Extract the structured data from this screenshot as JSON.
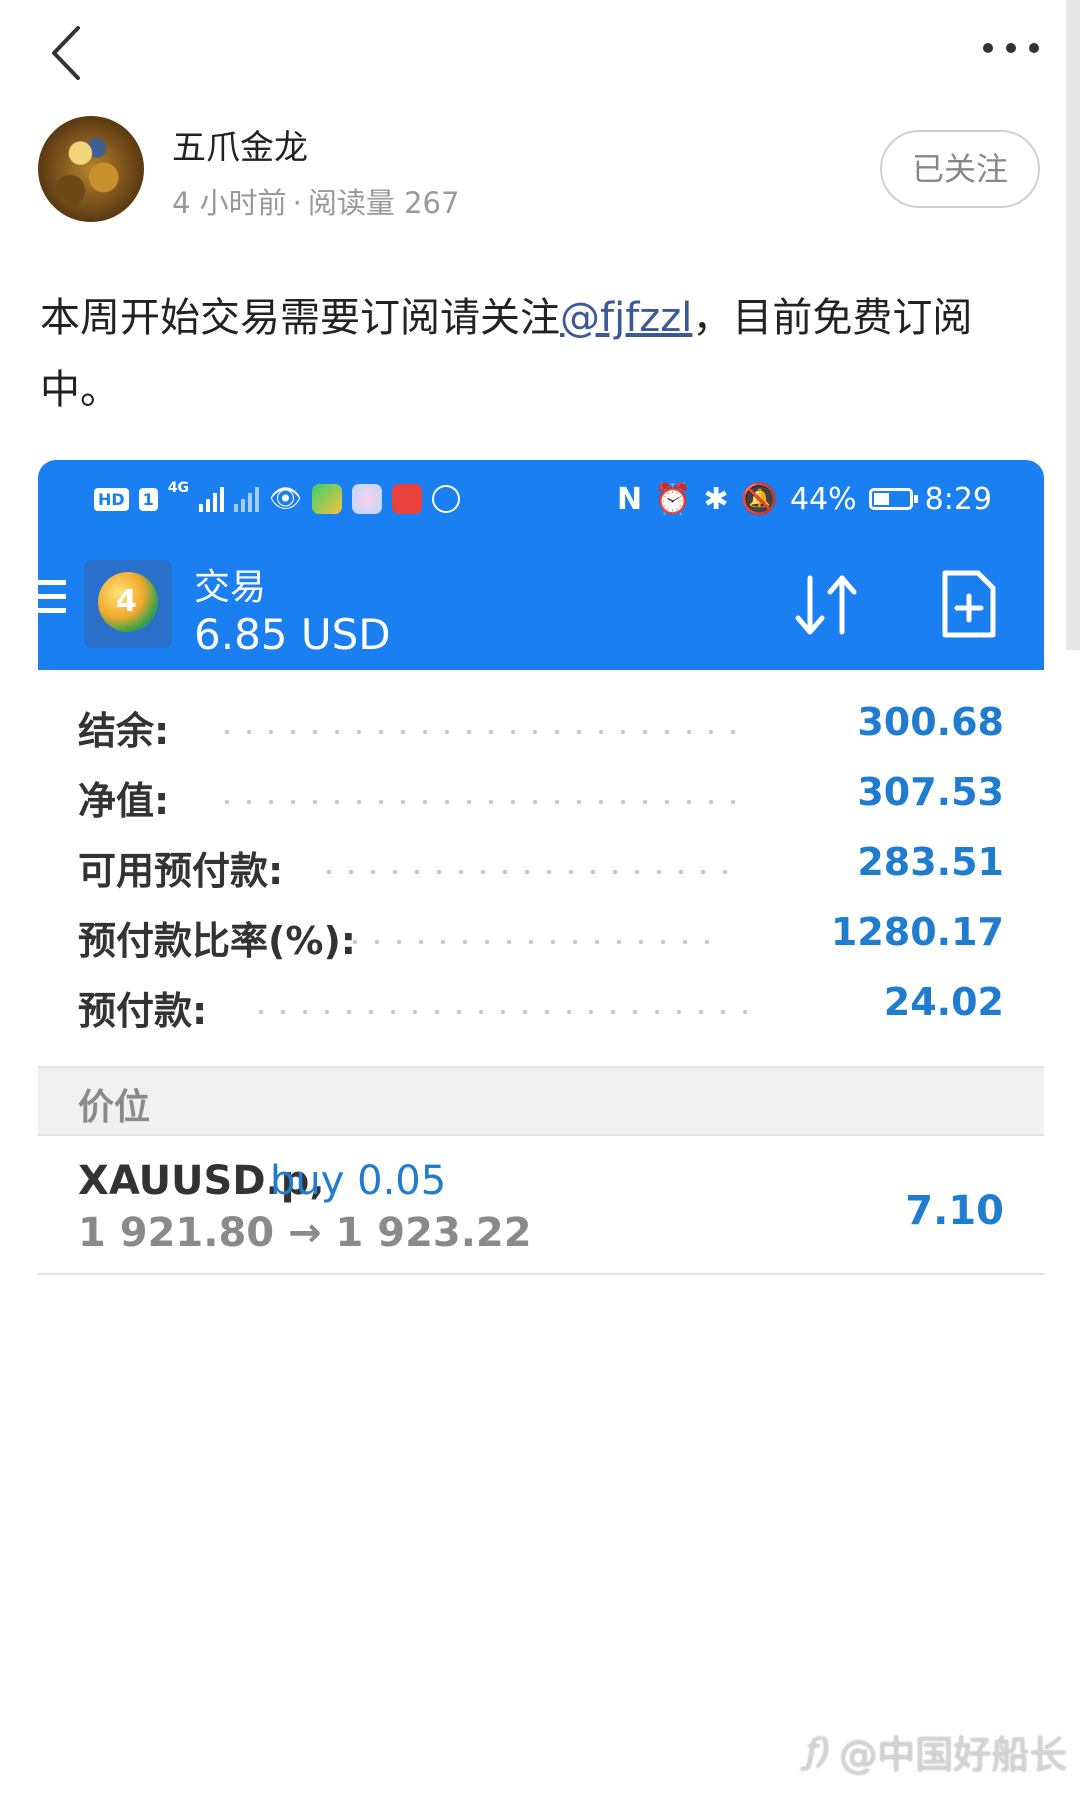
{
  "author": {
    "name": "五爪金龙",
    "time": "4 小时前",
    "separator": "·",
    "reads": "阅读量 267",
    "follow_label": "已关注"
  },
  "post": {
    "text_before": "本周开始交易需要订阅请关注",
    "mention": "@fjfzzl",
    "text_after": "，目前免费订阅中。"
  },
  "embedded_screenshot": {
    "status_bar": {
      "hd_badge": "HD",
      "sim_badge": "1",
      "network": "4G",
      "battery": "44%",
      "battery_level": 0.44,
      "time": "8:29"
    },
    "app_bar": {
      "title": "交易",
      "balance": "6.85 USD"
    },
    "account": [
      {
        "label": "结余:",
        "value": "300.68"
      },
      {
        "label": "净值:",
        "value": "307.53"
      },
      {
        "label": "可用预付款:",
        "value": "283.51"
      },
      {
        "label": "预付款比率(%):",
        "value": "1280.17"
      },
      {
        "label": "预付款:",
        "value": "24.02"
      }
    ],
    "positions_header": "价位",
    "position": {
      "symbol": "XAUUSD.p,",
      "side": "buy 0.05",
      "prices": "1 921.80 → 1 923.22",
      "profit": "7.10"
    }
  },
  "watermark": {
    "logo": "ƒ)",
    "text": "@中国好船长"
  },
  "colors": {
    "app_blue": "#1a7ff0",
    "value_blue": "#1f7ccf",
    "mention": "#3b5998"
  }
}
